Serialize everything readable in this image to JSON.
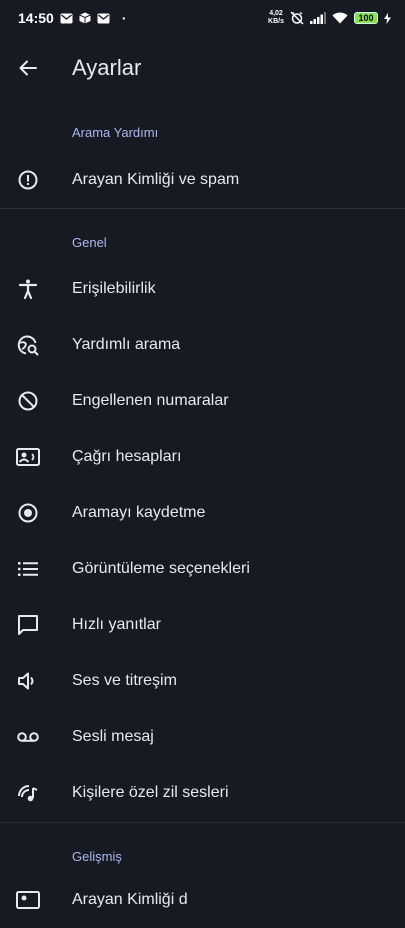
{
  "status_bar": {
    "time": "14:50",
    "dot": "·",
    "net_speed_value": "4,02",
    "net_speed_unit": "KB/s",
    "battery": "100"
  },
  "toolbar": {
    "title": "Ayarlar"
  },
  "sections": {
    "arama_yardimi": {
      "header": "Arama Yardımı",
      "items": [
        {
          "label": "Arayan Kimliği ve spam",
          "icon": "alert-circle-icon"
        }
      ]
    },
    "genel": {
      "header": "Genel",
      "items": [
        {
          "label": "Erişilebilirlik",
          "icon": "accessibility-icon"
        },
        {
          "label": "Yardımlı arama",
          "icon": "globe-search-icon"
        },
        {
          "label": "Engellenen numaralar",
          "icon": "block-icon"
        },
        {
          "label": "Çağrı hesapları",
          "icon": "contact-card-icon"
        },
        {
          "label": "Aramayı kaydetme",
          "icon": "record-icon"
        },
        {
          "label": "Görüntüleme seçenekleri",
          "icon": "list-icon"
        },
        {
          "label": "Hızlı yanıtlar",
          "icon": "message-icon"
        },
        {
          "label": "Ses ve titreşim",
          "icon": "volume-icon"
        },
        {
          "label": "Sesli mesaj",
          "icon": "voicemail-icon"
        },
        {
          "label": "Kişilere özel zil sesleri",
          "icon": "ringtone-icon"
        }
      ]
    },
    "gelismis": {
      "header": "Gelişmiş",
      "items": [
        {
          "label": "Arayan Kimliği d",
          "icon": "caller-id-icon"
        }
      ]
    }
  },
  "colors": {
    "background": "#171a22",
    "accent": "#a9b8ee",
    "text": "#e8e9ee"
  }
}
